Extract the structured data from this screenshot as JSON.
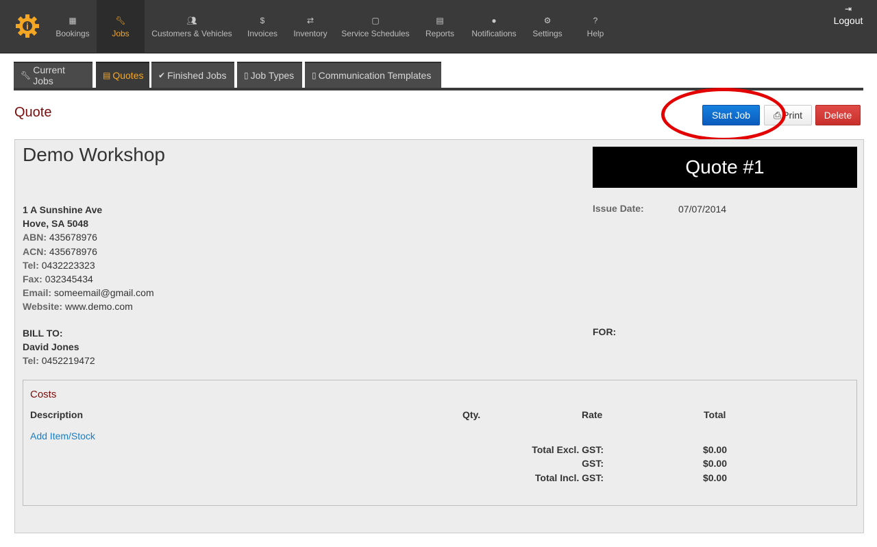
{
  "nav": {
    "items": [
      {
        "label": "Bookings",
        "icon": "calendar-icon"
      },
      {
        "label": "Jobs",
        "icon": "wrench-icon",
        "active": true
      },
      {
        "label": "Customers & Vehicles",
        "icon": "users-icon"
      },
      {
        "label": "Invoices",
        "icon": "dollar-icon"
      },
      {
        "label": "Inventory",
        "icon": "retweet-icon"
      },
      {
        "label": "Service Schedules",
        "icon": "calendar-empty-icon"
      },
      {
        "label": "Reports",
        "icon": "chart-icon"
      },
      {
        "label": "Notifications",
        "icon": "info-icon"
      },
      {
        "label": "Settings",
        "icon": "cogs-icon"
      },
      {
        "label": "Help",
        "icon": "question-icon"
      }
    ],
    "logout": "Logout"
  },
  "subtabs": [
    {
      "label": "Current Jobs",
      "icon": "wrench-icon"
    },
    {
      "label": "Quotes",
      "icon": "file-text-icon",
      "active": true
    },
    {
      "label": "Finished Jobs",
      "icon": "check-icon"
    },
    {
      "label": "Job Types",
      "icon": "file-icon"
    },
    {
      "label": "Communication Templates",
      "icon": "file-icon"
    }
  ],
  "page": {
    "title": "Quote",
    "start_job": "Start Job",
    "print": "Print",
    "delete": "Delete"
  },
  "quote": {
    "company": "Demo Workshop",
    "number": "Quote #1",
    "address1": "1 A Sunshine Ave",
    "address2": "Hove, SA 5048",
    "abn_label": "ABN:",
    "abn": "435678976",
    "acn_label": "ACN:",
    "acn": "435678976",
    "tel_label": "Tel:",
    "tel": "0432223323",
    "fax_label": "Fax:",
    "fax": "032345434",
    "email_label": "Email:",
    "email": "someemail@gmail.com",
    "website_label": "Website:",
    "website": "www.demo.com",
    "issue_label": "Issue Date:",
    "issue_date": "07/07/2014",
    "bill_to_label": "BILL TO:",
    "bill_name": "David Jones",
    "bill_tel_label": "Tel:",
    "bill_tel": "0452219472",
    "for_label": "FOR:"
  },
  "costs": {
    "title": "Costs",
    "headers": {
      "description": "Description",
      "qty": "Qty.",
      "rate": "Rate",
      "total": "Total"
    },
    "add_item": "Add Item/Stock",
    "totals": [
      {
        "label": "Total Excl. GST:",
        "value": "$0.00"
      },
      {
        "label": "GST:",
        "value": "$0.00"
      },
      {
        "label": "Total Incl. GST:",
        "value": "$0.00"
      }
    ]
  },
  "colors": {
    "accent": "#f5a623",
    "primary_button": "#0a63c9",
    "danger": "#d9534f",
    "highlight": "#e20000",
    "title": "#7a0c0c"
  }
}
